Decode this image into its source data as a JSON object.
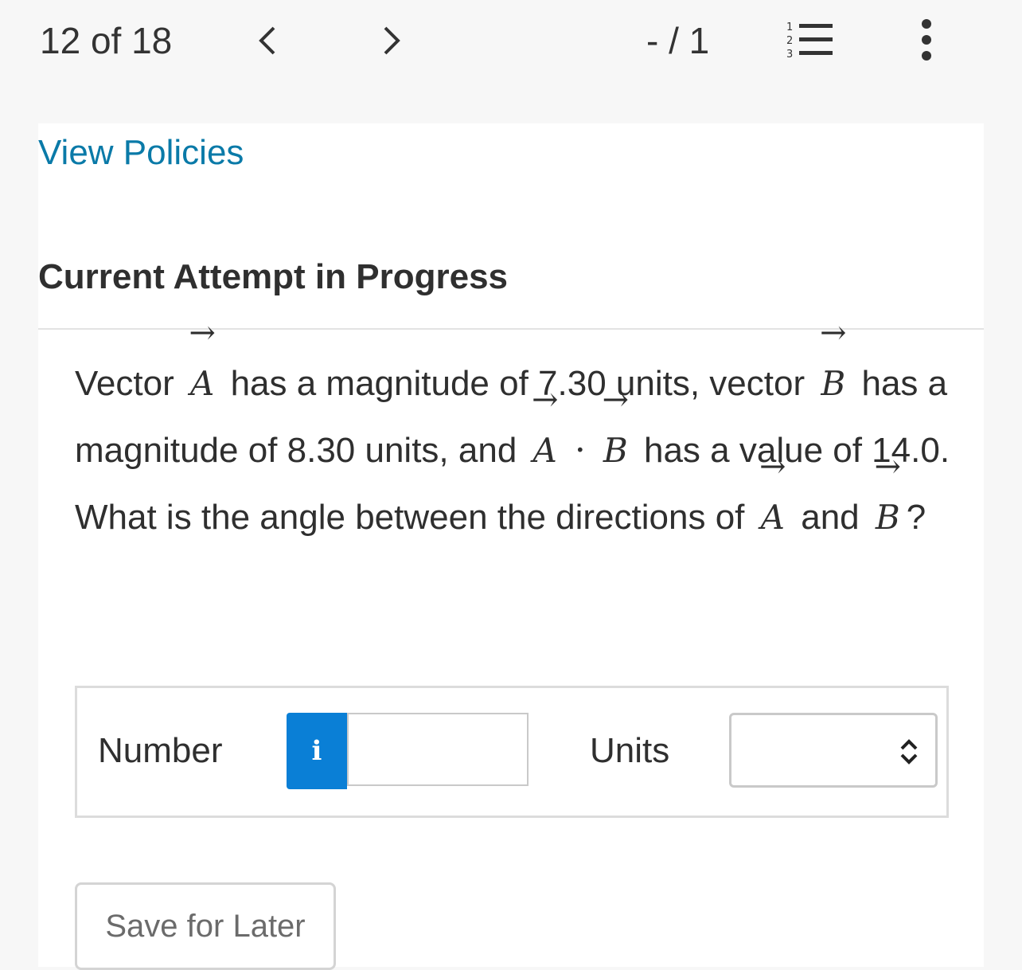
{
  "topbar": {
    "counter": "12 of 18",
    "score": "- / 1",
    "icons": {
      "prev": "chevron-left-icon",
      "next": "chevron-right-icon",
      "list": "numbered-list-icon",
      "more": "more-vertical-icon"
    }
  },
  "card": {
    "policies_link": "View Policies",
    "attempt_title": "Current Attempt in Progress"
  },
  "question": {
    "t1": "Vector",
    "vA": "A",
    "t2": "has a magnitude of 7.30 units, vector",
    "vB": "B",
    "t3": "has a magnitude of 8.30 units, and",
    "dot": "·",
    "t4": "has a value of 14.0. What is the angle between the directions of",
    "t5": "and",
    "q": "?"
  },
  "answer": {
    "number_label": "Number",
    "info_label": "i",
    "number_value": "",
    "units_label": "Units",
    "units_value": ""
  },
  "actions": {
    "save_label": "Save for Later"
  },
  "colors": {
    "link": "#0a7aa8",
    "info_button": "#0a7fd6",
    "background": "#f7f7f7"
  }
}
